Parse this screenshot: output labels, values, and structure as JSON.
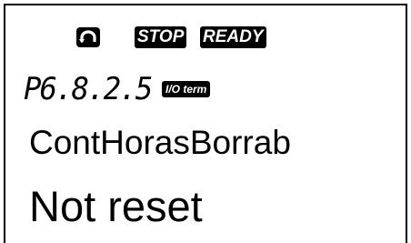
{
  "status_bar": {
    "rotation_icon": "rotation-direction-icon",
    "stop_label": "STOP",
    "ready_label": "READY"
  },
  "parameter": {
    "code": "P6.8.2.5",
    "control_place": "I/O term",
    "name": "ContHorasBorrab",
    "value": "Not reset"
  },
  "colors": {
    "background": "#ffffff",
    "foreground": "#000000"
  }
}
